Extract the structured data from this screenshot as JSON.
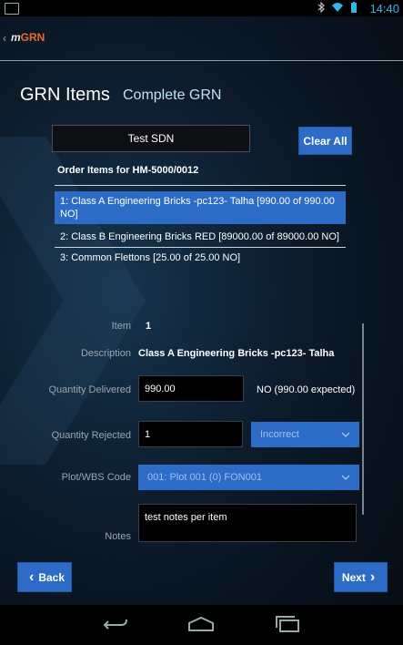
{
  "status_bar": {
    "time": "14:40",
    "icons": [
      "image-icon",
      "bluetooth-icon",
      "wifi-icon",
      "battery-icon"
    ]
  },
  "app": {
    "logo_prefix": "m",
    "logo_suffix": "GRN"
  },
  "page": {
    "title": "GRN Items",
    "subtitle": "Complete GRN"
  },
  "sdn": {
    "value": "Test SDN"
  },
  "buttons": {
    "clear_all": "Clear All",
    "back": "Back",
    "next": "Next"
  },
  "order_items": {
    "header": "Order Items for HM-5000/0012",
    "items": [
      {
        "label": "1: Class A Engineering Bricks -pc123- Talha [990.00 of 990.00 NO]",
        "selected": true
      },
      {
        "label": "2: Class B Engineering Bricks RED [89000.00 of 89000.00 NO]",
        "selected": false
      },
      {
        "label": "3: Common Flettons [25.00 of 25.00 NO]",
        "selected": false
      }
    ]
  },
  "form": {
    "item_label": "Item",
    "item_value": "1",
    "description_label": "Description",
    "description_value": "Class A Engineering Bricks -pc123- Talha",
    "qty_delivered_label": "Quantity Delivered",
    "qty_delivered_value": "990.00",
    "qty_delivered_note": "NO (990.00 expected)",
    "qty_rejected_label": "Quantity Rejected",
    "qty_rejected_value": "1",
    "rejection_reason": "Incorrect",
    "plot_label": "Plot/WBS Code",
    "plot_value": "001: Plot 001 (0) FON001",
    "notes_label": "Notes",
    "notes_value": "test notes per item"
  },
  "colors": {
    "accent": "#2c6bc6",
    "logo_orange": "#e8692c",
    "status_blue": "#33b5e5",
    "subtitle": "#bfe2f2"
  }
}
